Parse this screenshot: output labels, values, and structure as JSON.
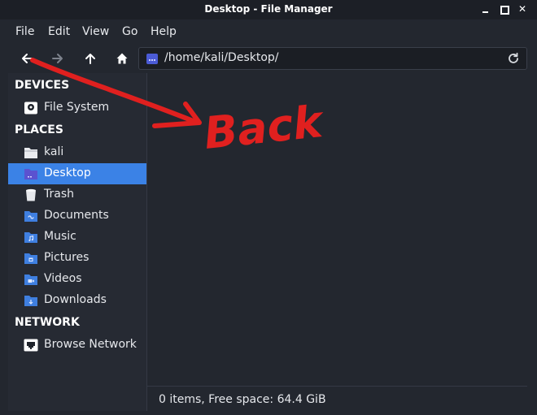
{
  "window": {
    "title": "Desktop - File Manager"
  },
  "menu": {
    "file": "File",
    "edit": "Edit",
    "view": "View",
    "go": "Go",
    "help": "Help"
  },
  "toolbar": {
    "back_icon": "arrow-left-icon",
    "forward_icon": "arrow-right-icon",
    "up_icon": "arrow-up-icon",
    "home_icon": "home-icon"
  },
  "address": {
    "path": "/home/kali/Desktop/"
  },
  "sidebar": {
    "devices_heading": "DEVICES",
    "places_heading": "PLACES",
    "network_heading": "NETWORK",
    "devices": [
      {
        "label": "File System",
        "icon": "drive-icon"
      }
    ],
    "places": [
      {
        "label": "kali",
        "icon": "home-folder-icon"
      },
      {
        "label": "Desktop",
        "icon": "desktop-folder-icon",
        "active": true
      },
      {
        "label": "Trash",
        "icon": "trash-icon"
      },
      {
        "label": "Documents",
        "icon": "documents-folder-icon"
      },
      {
        "label": "Music",
        "icon": "music-folder-icon"
      },
      {
        "label": "Pictures",
        "icon": "pictures-folder-icon"
      },
      {
        "label": "Videos",
        "icon": "videos-folder-icon"
      },
      {
        "label": "Downloads",
        "icon": "downloads-folder-icon"
      }
    ],
    "network": [
      {
        "label": "Browse Network",
        "icon": "network-icon"
      }
    ]
  },
  "status": {
    "text": "0 items, Free space: 64.4 GiB"
  },
  "annotation": {
    "text": "Back",
    "color": "#e0201f"
  },
  "colors": {
    "accent": "#3b82e6",
    "folder": "#3f7fe0",
    "background": "#23272f"
  }
}
